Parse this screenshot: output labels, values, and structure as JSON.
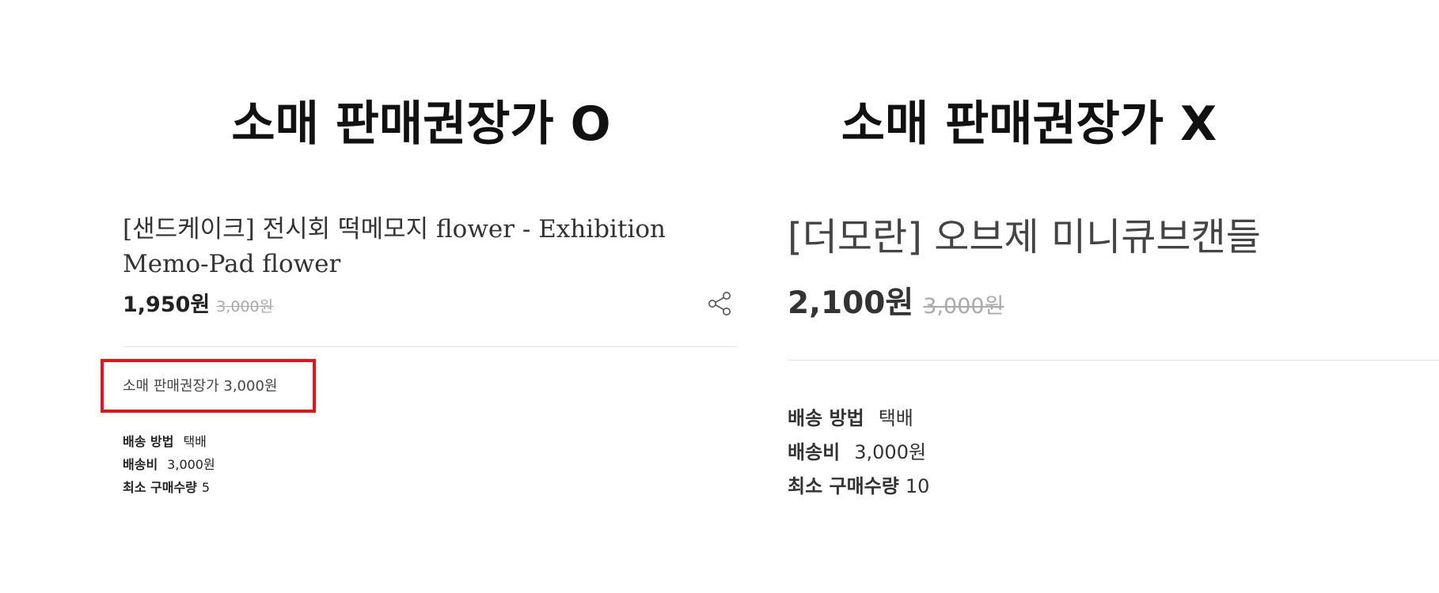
{
  "left": {
    "heading": "소매 판매권장가 O",
    "product_title": "[샌드케이크] 전시회 떡메모지 flower - Exhibition Memo-Pad flower",
    "price": "1,950원",
    "original_price": "3,000원",
    "share_icon": "share-icon",
    "retail_price_text": "소매 판매권장가 3,000원",
    "highlight_color": "#e3141b",
    "info": [
      {
        "label": "배송 방법",
        "value": "택배"
      },
      {
        "label": "배송비",
        "value": "3,000원"
      },
      {
        "label": "최소 구매수량",
        "value": "5"
      }
    ]
  },
  "right": {
    "heading": "소매 판매권장가 X",
    "product_title": "[더모란] 오브제 미니큐브캔들",
    "price": "2,100원",
    "original_price": "3,000원",
    "info": [
      {
        "label": "배송 방법",
        "value": "택배"
      },
      {
        "label": "배송비",
        "value": "3,000원"
      },
      {
        "label": "최소 구매수량",
        "value": "10"
      }
    ]
  }
}
